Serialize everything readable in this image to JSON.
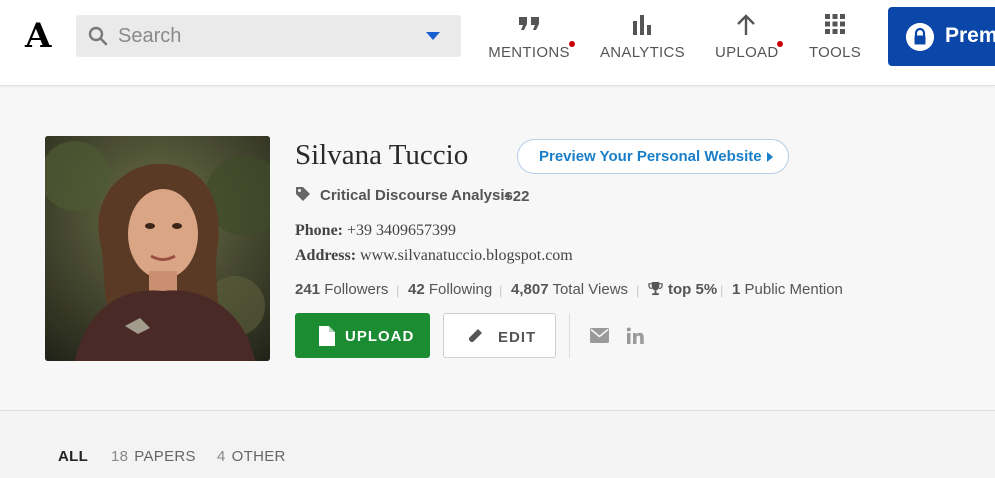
{
  "header": {
    "logo": "A",
    "search": {
      "placeholder": "Search"
    },
    "nav": [
      {
        "label": "MENTIONS",
        "icon": "quote-icon",
        "has_notification": true
      },
      {
        "label": "ANALYTICS",
        "icon": "bar-chart-icon",
        "has_notification": false
      },
      {
        "label": "UPLOAD",
        "icon": "arrow-up-icon",
        "has_notification": true
      },
      {
        "label": "TOOLS",
        "icon": "grid-icon",
        "has_notification": false
      }
    ],
    "premium_label": "Premium"
  },
  "profile": {
    "name": "Silvana Tuccio",
    "preview_website_label": "Preview Your Personal Website",
    "tag": "Critical Discourse Analysis",
    "tag_more": "+22",
    "phone_label": "Phone:",
    "phone_value": "+39 3409657399",
    "address_label": "Address:",
    "address_value": "www.silvanatuccio.blogspot.com",
    "stats": {
      "followers_count": "241",
      "followers_label": "Followers",
      "following_count": "42",
      "following_label": "Following",
      "views_count": "4,807",
      "views_label": "Total Views",
      "rank": "top 5%",
      "mentions_count": "1",
      "mentions_label": "Public Mention"
    },
    "upload_label": "UPLOAD",
    "edit_label": "EDIT"
  },
  "tabs": [
    {
      "count": "",
      "label": "ALL",
      "active": true
    },
    {
      "count": "18",
      "label": "PAPERS",
      "active": false
    },
    {
      "count": "4",
      "label": "OTHER",
      "active": false
    }
  ],
  "colors": {
    "brand_blue": "#0b47a8",
    "upload_green": "#1b8c31",
    "link_blue": "#1a7fc9",
    "notification_red": "#cc0000"
  }
}
